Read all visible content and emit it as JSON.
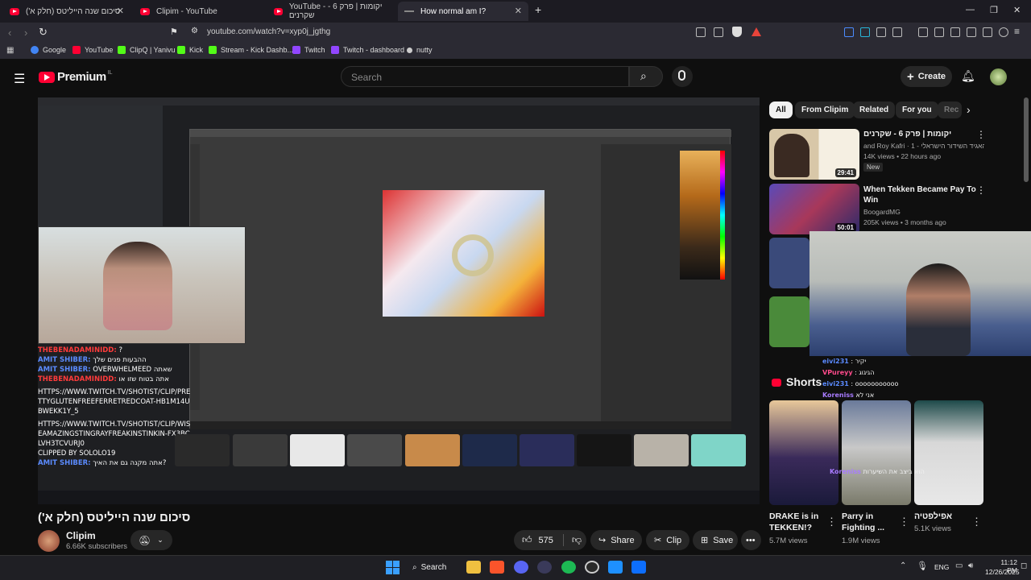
{
  "browser": {
    "tabs": [
      {
        "label": "סיכום שנה הייליטס (חלק א')",
        "active": false
      },
      {
        "label": "Clipim - YouTube",
        "active": false
      },
      {
        "label": "YouTube - יקומות | פרק 6 - שקרנים",
        "active": false
      },
      {
        "label": "How normal am I?",
        "active": true
      }
    ],
    "url": "youtube.com/watch?v=xyp0j_jgthg",
    "bookmarks": [
      "Google",
      "YouTube",
      "ClipQ | Yanivu",
      "Kick",
      "Stream - Kick Dashb...",
      "Twitch",
      "Twitch - dashboard",
      "nutty"
    ]
  },
  "youtube": {
    "logo": "Premium",
    "logo_region": "IL",
    "search_placeholder": "Search",
    "create_label": "Create"
  },
  "video": {
    "title": "סיכום שנה הייליטס (חלק א')",
    "channel": "Clipim",
    "subscribers": "6.66K subscribers",
    "likes": "575",
    "share_label": "Share",
    "clip_label": "Clip",
    "save_label": "Save",
    "stream_chat": [
      {
        "user": "THEBENADAMINIDD:",
        "msg": "?"
      },
      {
        "user": "AMIT SHIBER:",
        "msg": "ההבעות פנים שלך"
      },
      {
        "user": "AMIT SHIBER:",
        "msg": "OVERWHELMEED שאתה"
      },
      {
        "user": "THEBENADAMINIDD:",
        "msg": "אתה בטוח שזו או"
      },
      {
        "user": "",
        "msg": "HTTPS://WWW.TWITCH.TV/SHOTIST/CLIP/PRETTYGLUTENFREEFERRETREDCOAT-HB1M14UBWEKK1Y_5"
      },
      {
        "user": "",
        "msg": "HTTPS://WWW.TWITCH.TV/SHOTIST/CLIP/WISEAMAZINGSTINGRAYFREAKINSTINKIN-FX3BCLVH3TCVURJ0"
      },
      {
        "user": "",
        "msg": "CLIPPED BY SOLOLO19"
      },
      {
        "user": "AMIT SHIBER:",
        "msg": "אתה מקנה גם את האיך?"
      }
    ]
  },
  "sidebar": {
    "chips": [
      "All",
      "From Clipim",
      "Related",
      "For you",
      "Rec"
    ],
    "items": [
      {
        "title": "יקומות | פרק 6 - שקרנים",
        "channel": "and Roy Kafri · האגיד השידור הישראלי - 1...",
        "meta": "14K views • 22 hours ago",
        "badge": "New",
        "duration": "29:41"
      },
      {
        "title": "When Tekken Became Pay To Win",
        "channel": "BoogardMG",
        "meta": "205K views • 3 months ago",
        "badge": "",
        "duration": "50:01"
      }
    ],
    "shorts_heading": "Shorts",
    "shorts": [
      {
        "title": "DRAKE is in TEKKEN!?",
        "views": "5.7M views"
      },
      {
        "title": "Parry in Fighting ...",
        "views": "1.9M views"
      },
      {
        "title": "אפילפטיה",
        "views": "5.1K views"
      }
    ],
    "overlay_chat": [
      {
        "user": "eivi231",
        "msg": ": יקיר"
      },
      {
        "user": "VPureyy",
        "msg": ": הגיגוג"
      },
      {
        "user": "eivi231",
        "msg": ": ooooooooooo"
      },
      {
        "user": "Koreniss",
        "msg": "אני לא"
      },
      {
        "user": "Koreniss",
        "msg": "הוא ביצב את השיערות"
      }
    ]
  },
  "taskbar": {
    "search_label": "Search",
    "lang": "ENG",
    "time": "11:12 PM",
    "date": "12/26/2025"
  },
  "colors": {
    "yt_red": "#ff0033",
    "bg": "#0f0f0f",
    "chip": "#272727"
  }
}
